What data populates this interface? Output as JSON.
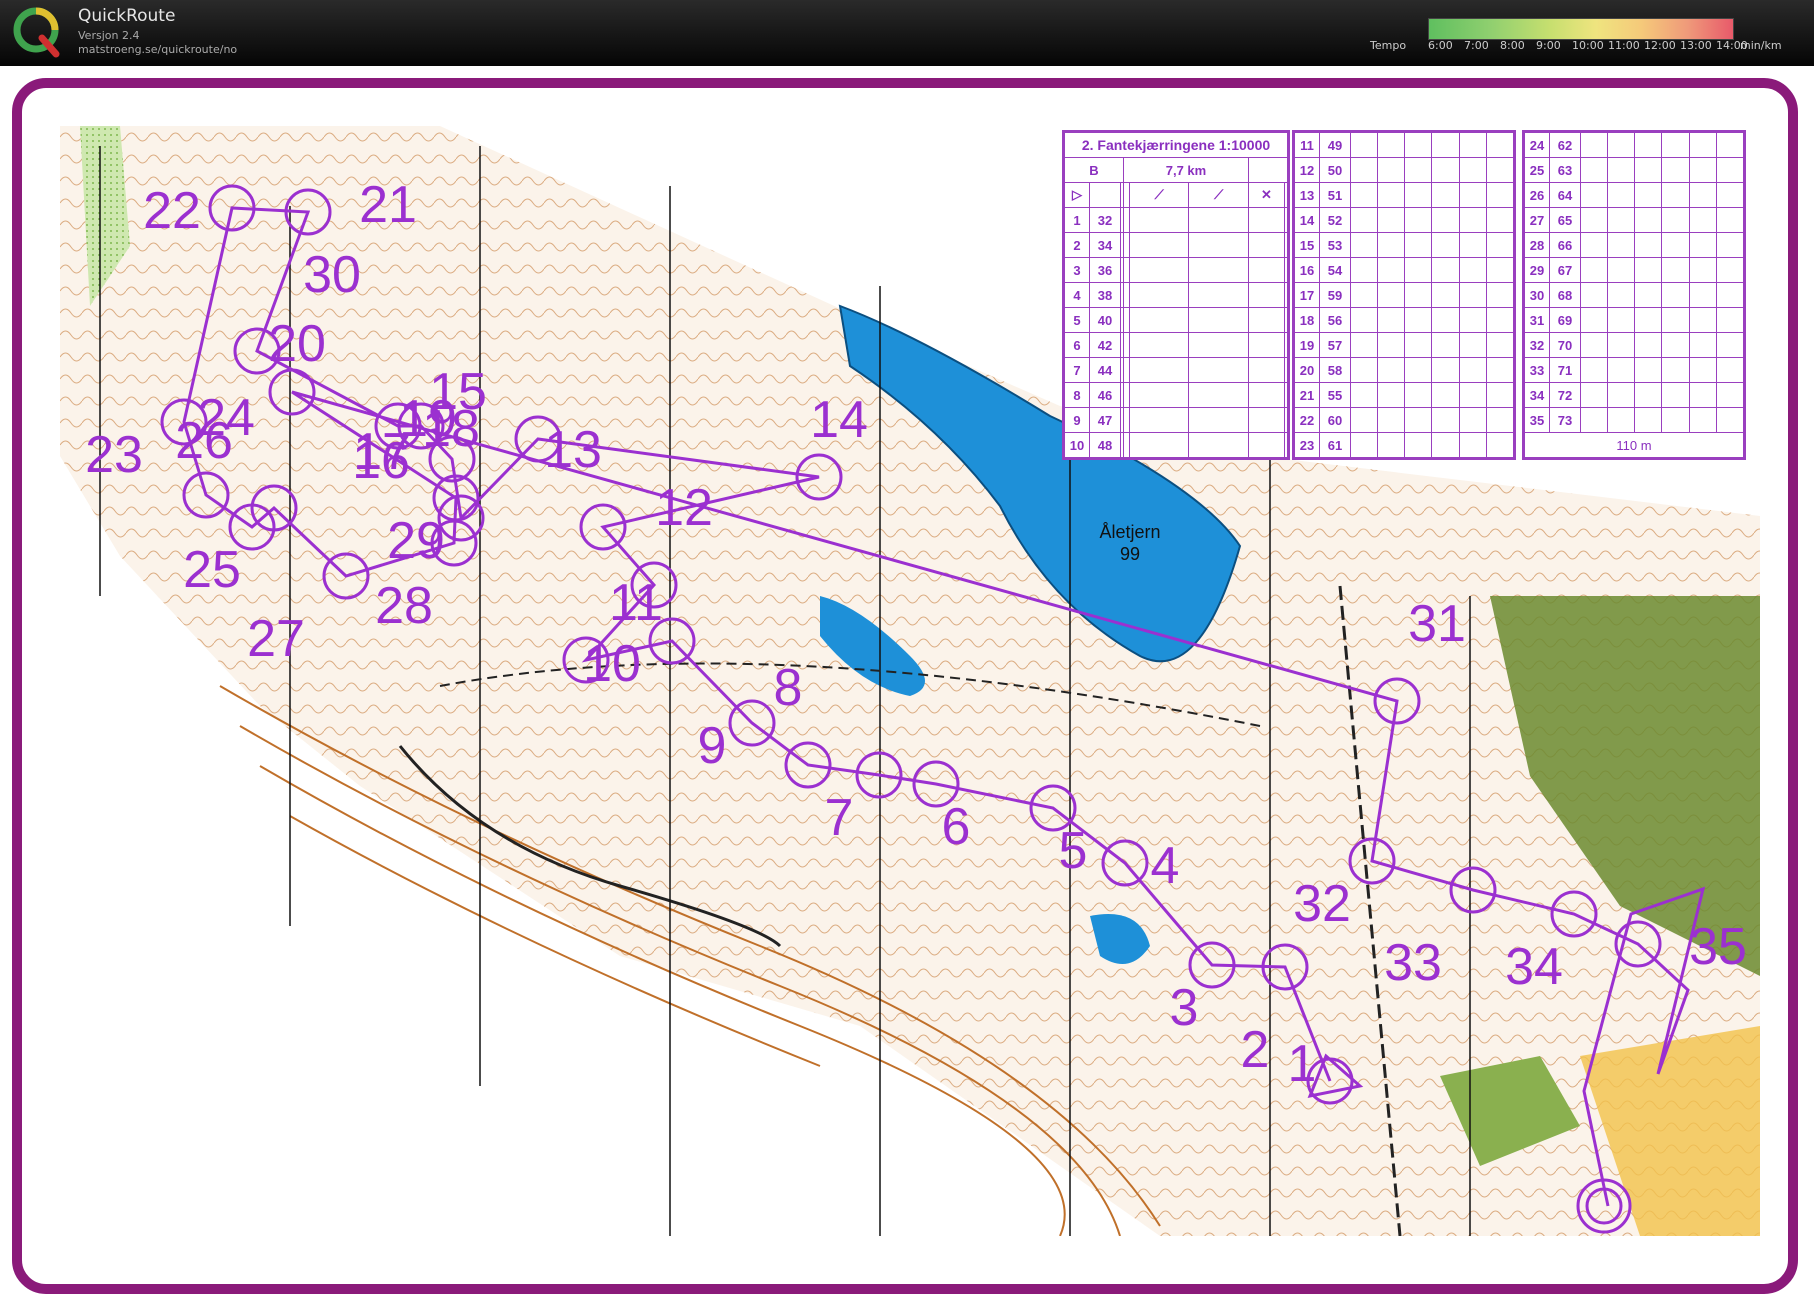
{
  "app": {
    "title": "QuickRoute",
    "version": "Versjon 2.4",
    "url": "matstroeng.se/quickroute/no"
  },
  "legend": {
    "label": "Tempo",
    "ticks": [
      "6:00",
      "7:00",
      "8:00",
      "9:00",
      "10:00",
      "11:00",
      "12:00",
      "13:00",
      "14:00"
    ],
    "unit": "min/km"
  },
  "map": {
    "lake_name": "Åletjern",
    "lake_height": "99",
    "controls": [
      "1",
      "2",
      "3",
      "4",
      "5",
      "6",
      "7",
      "8",
      "9",
      "10",
      "11",
      "12",
      "13",
      "14",
      "15",
      "16",
      "17",
      "18",
      "19",
      "20",
      "21",
      "22",
      "23",
      "24",
      "25",
      "26",
      "27",
      "28",
      "29",
      "30",
      "31",
      "32",
      "33",
      "34",
      "35"
    ]
  },
  "description": {
    "title": "2. Fantekjærringene 1:10000",
    "class": "B",
    "length": "7,7 km",
    "finish_distance": "110 m",
    "col1": [
      [
        "1",
        "32"
      ],
      [
        "2",
        "34"
      ],
      [
        "3",
        "36"
      ],
      [
        "4",
        "38"
      ],
      [
        "5",
        "40"
      ],
      [
        "6",
        "42"
      ],
      [
        "7",
        "44"
      ],
      [
        "8",
        "46"
      ],
      [
        "9",
        "47"
      ],
      [
        "10",
        "48"
      ]
    ],
    "col2": [
      [
        "11",
        "49"
      ],
      [
        "12",
        "50"
      ],
      [
        "13",
        "51"
      ],
      [
        "14",
        "52"
      ],
      [
        "15",
        "53"
      ],
      [
        "16",
        "54"
      ],
      [
        "17",
        "59"
      ],
      [
        "18",
        "56"
      ],
      [
        "19",
        "57"
      ],
      [
        "20",
        "58"
      ],
      [
        "21",
        "55"
      ],
      [
        "22",
        "60"
      ],
      [
        "23",
        "61"
      ]
    ],
    "col3": [
      [
        "24",
        "62"
      ],
      [
        "25",
        "63"
      ],
      [
        "26",
        "64"
      ],
      [
        "27",
        "65"
      ],
      [
        "28",
        "66"
      ],
      [
        "29",
        "67"
      ],
      [
        "30",
        "68"
      ],
      [
        "31",
        "69"
      ],
      [
        "32",
        "70"
      ],
      [
        "33",
        "71"
      ],
      [
        "34",
        "72"
      ],
      [
        "35",
        "73"
      ]
    ]
  },
  "colors": {
    "frame": "#8a1a7a",
    "course": "#9b30d0",
    "water": "#1e90d8",
    "contour": "#c0702a"
  }
}
